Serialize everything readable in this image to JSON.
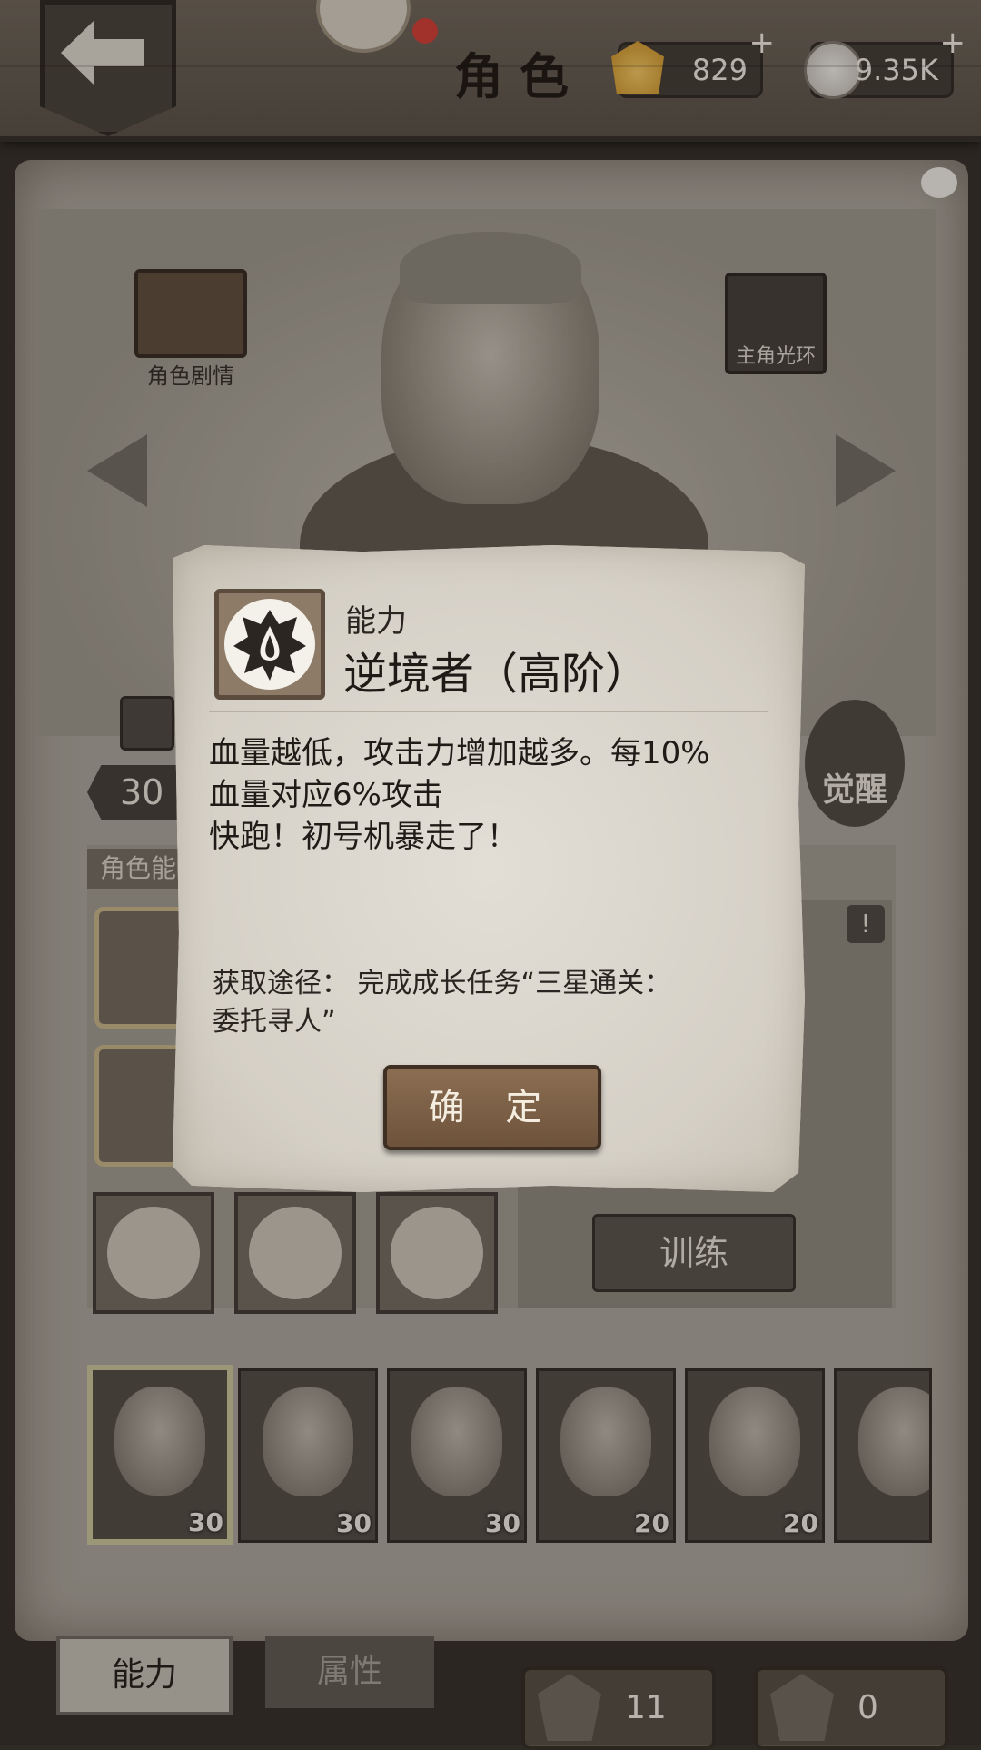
{
  "header": {
    "title": "角色",
    "currency_shell": "829",
    "currency_coin": "9.35K",
    "plus": "+"
  },
  "side_icons": {
    "story_label": "角色剧情",
    "aura_label": "主角光环"
  },
  "background": {
    "level": "30",
    "awaken_label": "觉醒",
    "section_label": "角色能",
    "train_label": "训练",
    "warn": "!"
  },
  "roster": [
    {
      "level": "30",
      "selected": true
    },
    {
      "level": "30",
      "selected": false
    },
    {
      "level": "30",
      "selected": false
    },
    {
      "level": "20",
      "selected": false
    },
    {
      "level": "20",
      "selected": false
    },
    {
      "level": "",
      "selected": false
    }
  ],
  "tabs": {
    "ability": "能力",
    "attribute": "属性"
  },
  "counters": {
    "left": "11",
    "right": "0"
  },
  "dialog": {
    "type": "能力",
    "name": "逆境者（高阶）",
    "description_lines": [
      "血量越低，攻击力增加越多。每10%",
      "血量对应6%攻击",
      "快跑！初号机暴走了！"
    ],
    "source_lines": [
      "获取途径：  完成成长任务“三星通关：",
      "委托寻人”"
    ],
    "confirm_label": "确 定"
  },
  "colors": {
    "parchment": "#a8a49b",
    "dialog_bg": "#dcd8d0",
    "button_wood": "#7b5e45"
  }
}
